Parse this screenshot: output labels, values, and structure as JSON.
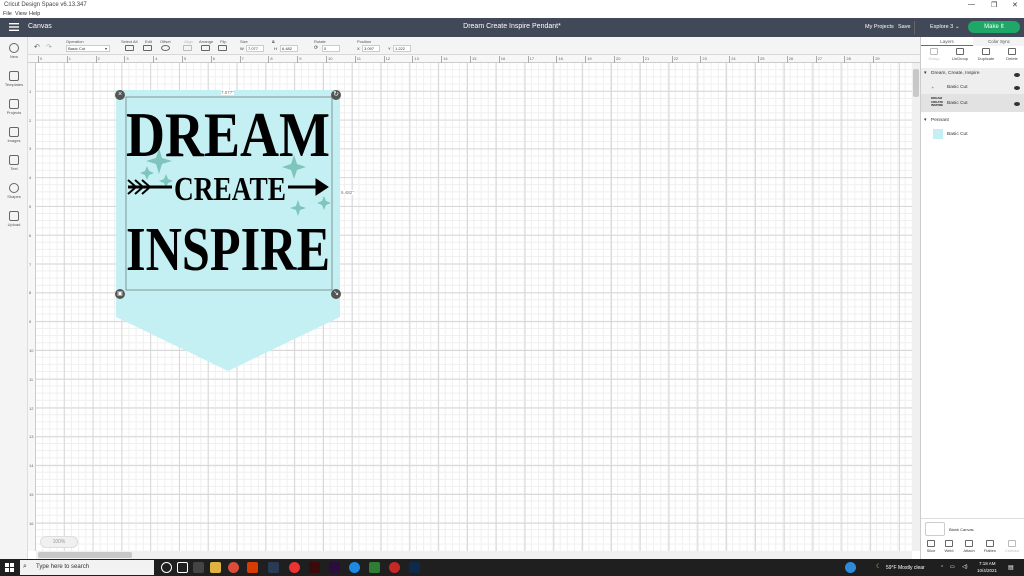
{
  "window": {
    "app_title": "Cricut Design Space  v6.13.347",
    "menu": [
      "File",
      "View",
      "Help"
    ],
    "controls": [
      "—",
      "❐",
      "✕"
    ]
  },
  "header": {
    "section": "Canvas",
    "document_title": "Dream Create Inspire Pendant*",
    "my_projects": "My Projects",
    "save": "Save",
    "machine": "Explore 3",
    "make_it": "Make It",
    "accent": "#1fa768",
    "bg": "#414857"
  },
  "toolbar": {
    "operation_label": "Operation",
    "operation_value": "Basic Cut",
    "select_all": "Select All",
    "edit": "Edit",
    "offset": "Offset",
    "align": "Align",
    "arrange": "Arrange",
    "flip": "Flip",
    "size": "Size",
    "w_label": "W",
    "w_value": "7.077",
    "h_label": "H",
    "h_value": "6.482",
    "rotate": "Rotate",
    "rotate_value": "0",
    "position": "Position",
    "x_label": "X",
    "x_value": "3.097",
    "y_label": "Y",
    "y_value": "1.222"
  },
  "leftbar": [
    "New",
    "Templates",
    "Projects",
    "Images",
    "Text",
    "Shapes",
    "Upload"
  ],
  "rulers": {
    "h": [
      "0",
      "1",
      "2",
      "3",
      "4",
      "5",
      "6",
      "7",
      "8",
      "9",
      "10",
      "11",
      "12",
      "13",
      "14",
      "15",
      "16",
      "17",
      "18",
      "19",
      "20",
      "21",
      "22",
      "23",
      "24",
      "25",
      "26",
      "27",
      "28",
      "29"
    ],
    "v": [
      "1",
      "2",
      "3",
      "4",
      "5",
      "6",
      "7",
      "8",
      "9",
      "10",
      "11",
      "12",
      "13",
      "14",
      "15",
      "16"
    ]
  },
  "design": {
    "line1": "DREAM",
    "line2": "CREATE",
    "line3": "INSPIRE",
    "width_label": "7.077\"",
    "height_label": "6.482\"",
    "pennant_color": "#c4f0f3",
    "sparkle_color": "#7fc4bd",
    "text_color": "#000000"
  },
  "zoom": "100%",
  "layers_panel": {
    "tabs": [
      "Layers",
      "Color Sync"
    ],
    "tools": [
      "Group",
      "UnGroup",
      "Duplicate",
      "Delete"
    ],
    "groups": [
      {
        "name": "Dream, Create, Inspire",
        "items": [
          {
            "label": "Basic Cut"
          },
          {
            "label": "Basic Cut"
          }
        ]
      },
      {
        "name": "Pennant",
        "items": [
          {
            "label": "Basic Cut"
          }
        ]
      }
    ],
    "blank_canvas": "Blank Canvas",
    "bottom_tools": [
      "Slice",
      "Weld",
      "Attach",
      "Flatten",
      "Contour"
    ]
  },
  "taskbar": {
    "search": "Type here to search",
    "weather": "59°F  Mostly clear",
    "time": "7:18 AM",
    "date": "10/4/2021"
  }
}
